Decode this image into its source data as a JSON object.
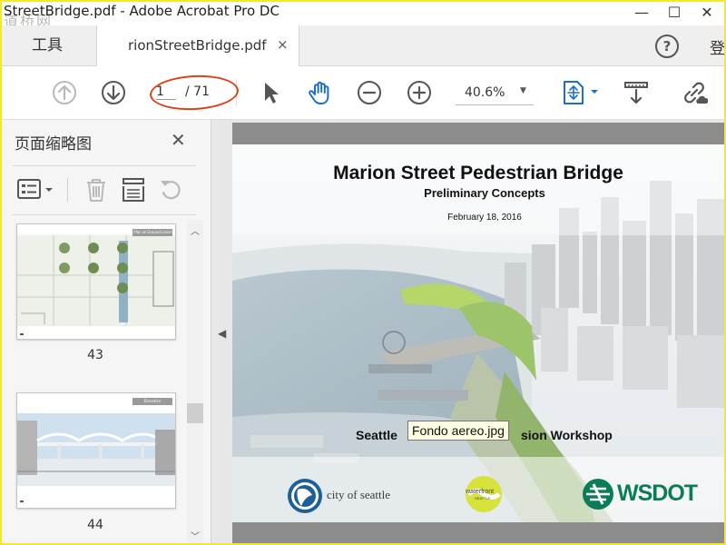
{
  "window": {
    "title": "StreetBridge.pdf - Adobe Acrobat Pro DC",
    "watermark": "道桥网",
    "controls": {
      "minimize": "—",
      "maximize": "☐",
      "close": "✕"
    }
  },
  "tabs": {
    "tools_label": "工具",
    "document_label": "rionStreetBridge.pdf",
    "close_glyph": "×",
    "help_glyph": "?",
    "login_label": "登"
  },
  "toolbar": {
    "page_current": "1",
    "page_total": "/ 71",
    "zoom_value": "40.6%",
    "icons": [
      "prev-page-icon",
      "next-page-icon",
      "select-arrow-icon",
      "hand-icon",
      "zoom-out-icon",
      "zoom-in-icon",
      "fit-page-icon",
      "scroll-mode-icon",
      "share-link-icon"
    ],
    "accent_color": "#1c6fc9"
  },
  "sidebar": {
    "title": "页面缩略图",
    "close_glyph": "✕",
    "tools": [
      "page-options-icon",
      "delete-icon",
      "extract-icon",
      "rotate-icon"
    ],
    "thumbnails": [
      {
        "page": "43",
        "caption": "Plan at Ground Level"
      },
      {
        "page": "44",
        "caption": "Elevation"
      }
    ]
  },
  "document": {
    "title": "Marion Street Pedestrian Bridge",
    "subtitle": "Preliminary Concepts",
    "date": "February 18, 2016",
    "workshop_left": "Seattle",
    "workshop_right": "sion Workshop",
    "tooltip": "Fondo aereo.jpg",
    "logos": {
      "city": "city of seattle",
      "waterfront_top": "waterfront",
      "waterfront_bottom": "SEATTLE",
      "wsdot": "WSDOT"
    },
    "colors": {
      "wsdot_green": "#0a7d55",
      "waterfront_yellow": "#d7e23a"
    }
  }
}
